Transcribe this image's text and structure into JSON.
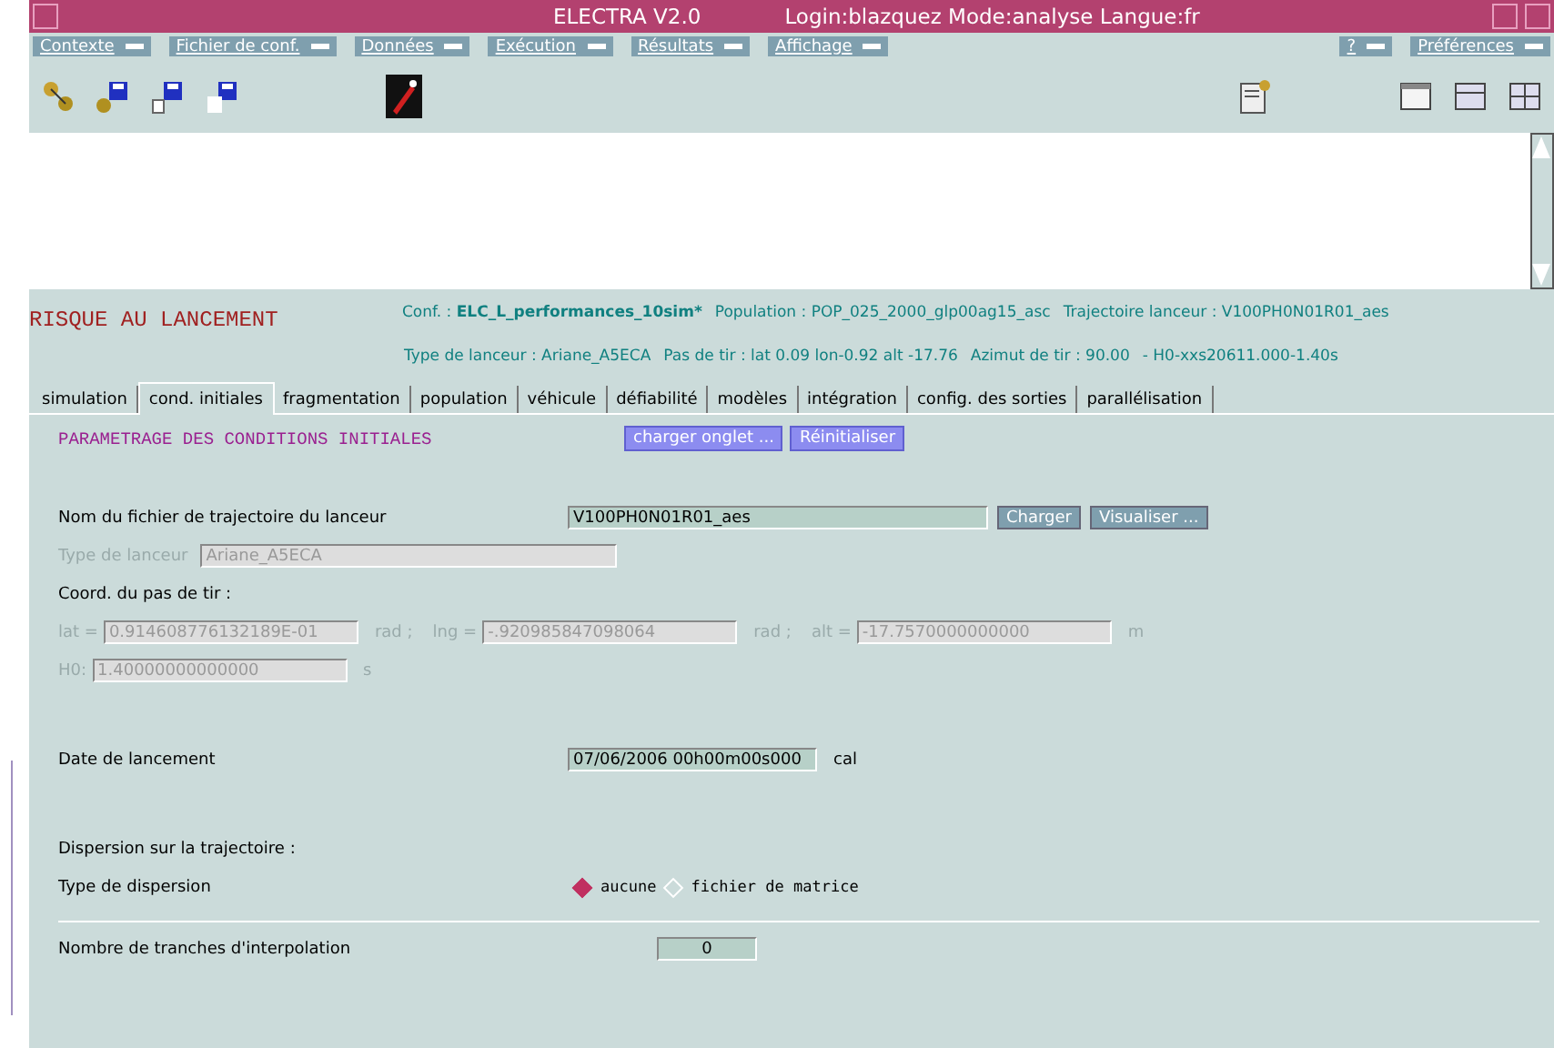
{
  "window": {
    "title": "ELECTRA V2.0",
    "session": "Login:blazquez Mode:analyse Langue:fr"
  },
  "menus_left": [
    "Contexte",
    "Fichier de conf.",
    "Données",
    "Exécution",
    "Résultats",
    "Affichage"
  ],
  "menus_right": [
    "?",
    "Préférences"
  ],
  "header": {
    "title": "RISQUE AU LANCEMENT",
    "conf": {
      "label": "Conf. :",
      "value": "ELC_L_performances_10sim*"
    },
    "line1": [
      {
        "label": "Population :",
        "value": "POP_025_2000_glp00ag15_asc"
      },
      {
        "label": "Trajectoire lanceur :",
        "value": "V100PH0N01R01_aes"
      }
    ],
    "line2": [
      {
        "label": "Type de lanceur :",
        "value": "Ariane_A5ECA"
      },
      {
        "label": "Pas de tir :",
        "value": "lat 0.09 lon-0.92 alt -17.76"
      },
      {
        "label": "Azimut de tir :",
        "value": "90.00"
      },
      {
        "value": "- H0-xxs20611.000-1.40s"
      }
    ]
  },
  "tabs": [
    {
      "label": "simulation",
      "selected": false
    },
    {
      "label": "cond. initiales",
      "selected": true
    },
    {
      "label": "fragmentation",
      "selected": false
    },
    {
      "label": "population",
      "selected": false
    },
    {
      "label": "véhicule",
      "selected": false
    },
    {
      "label": "défiabilité",
      "selected": false
    },
    {
      "label": "modèles",
      "selected": false
    },
    {
      "label": "intégration",
      "selected": false
    },
    {
      "label": "config. des sorties",
      "selected": false
    },
    {
      "label": "parallélisation",
      "selected": false
    }
  ],
  "panel": {
    "title": "PARAMETRAGE DES CONDITIONS INITIALES",
    "buttons": [
      "charger onglet ...",
      "Réinitialiser"
    ],
    "trajectory": {
      "label": "Nom du fichier de trajectoire du lanceur",
      "value": "V100PH0N01R01_aes",
      "buttons": [
        "Charger",
        "Visualiser ..."
      ]
    },
    "launcher_type": {
      "label": "Type de lanceur",
      "value": "Ariane_A5ECA",
      "disabled": true
    },
    "coords_title": "Coord. du pas de tir :",
    "coords_disabled": true,
    "coords": [
      {
        "label": "lat =",
        "value": "0.914608776132189E-01",
        "unit": "rad ;"
      },
      {
        "label": "lng =",
        "value": "-.920985847098064",
        "unit": "rad ;"
      },
      {
        "label": "alt =",
        "value": "-17.7570000000000",
        "unit": "m"
      }
    ],
    "h0": {
      "label": "H0:",
      "value": "1.40000000000000",
      "unit": "s",
      "disabled": true
    },
    "launch_date": {
      "label": "Date de lancement",
      "value": "07/06/2006 00h00m00s000",
      "unit": "cal"
    },
    "dispersion_title": "Dispersion sur la trajectoire :",
    "dispersion": {
      "label": "Type de dispersion",
      "options": [
        {
          "label": "aucune",
          "selected": true
        },
        {
          "label": "fichier de matrice",
          "selected": false
        }
      ]
    },
    "slices": {
      "label": "Nombre de tranches d'interpolation",
      "value": "0"
    }
  }
}
